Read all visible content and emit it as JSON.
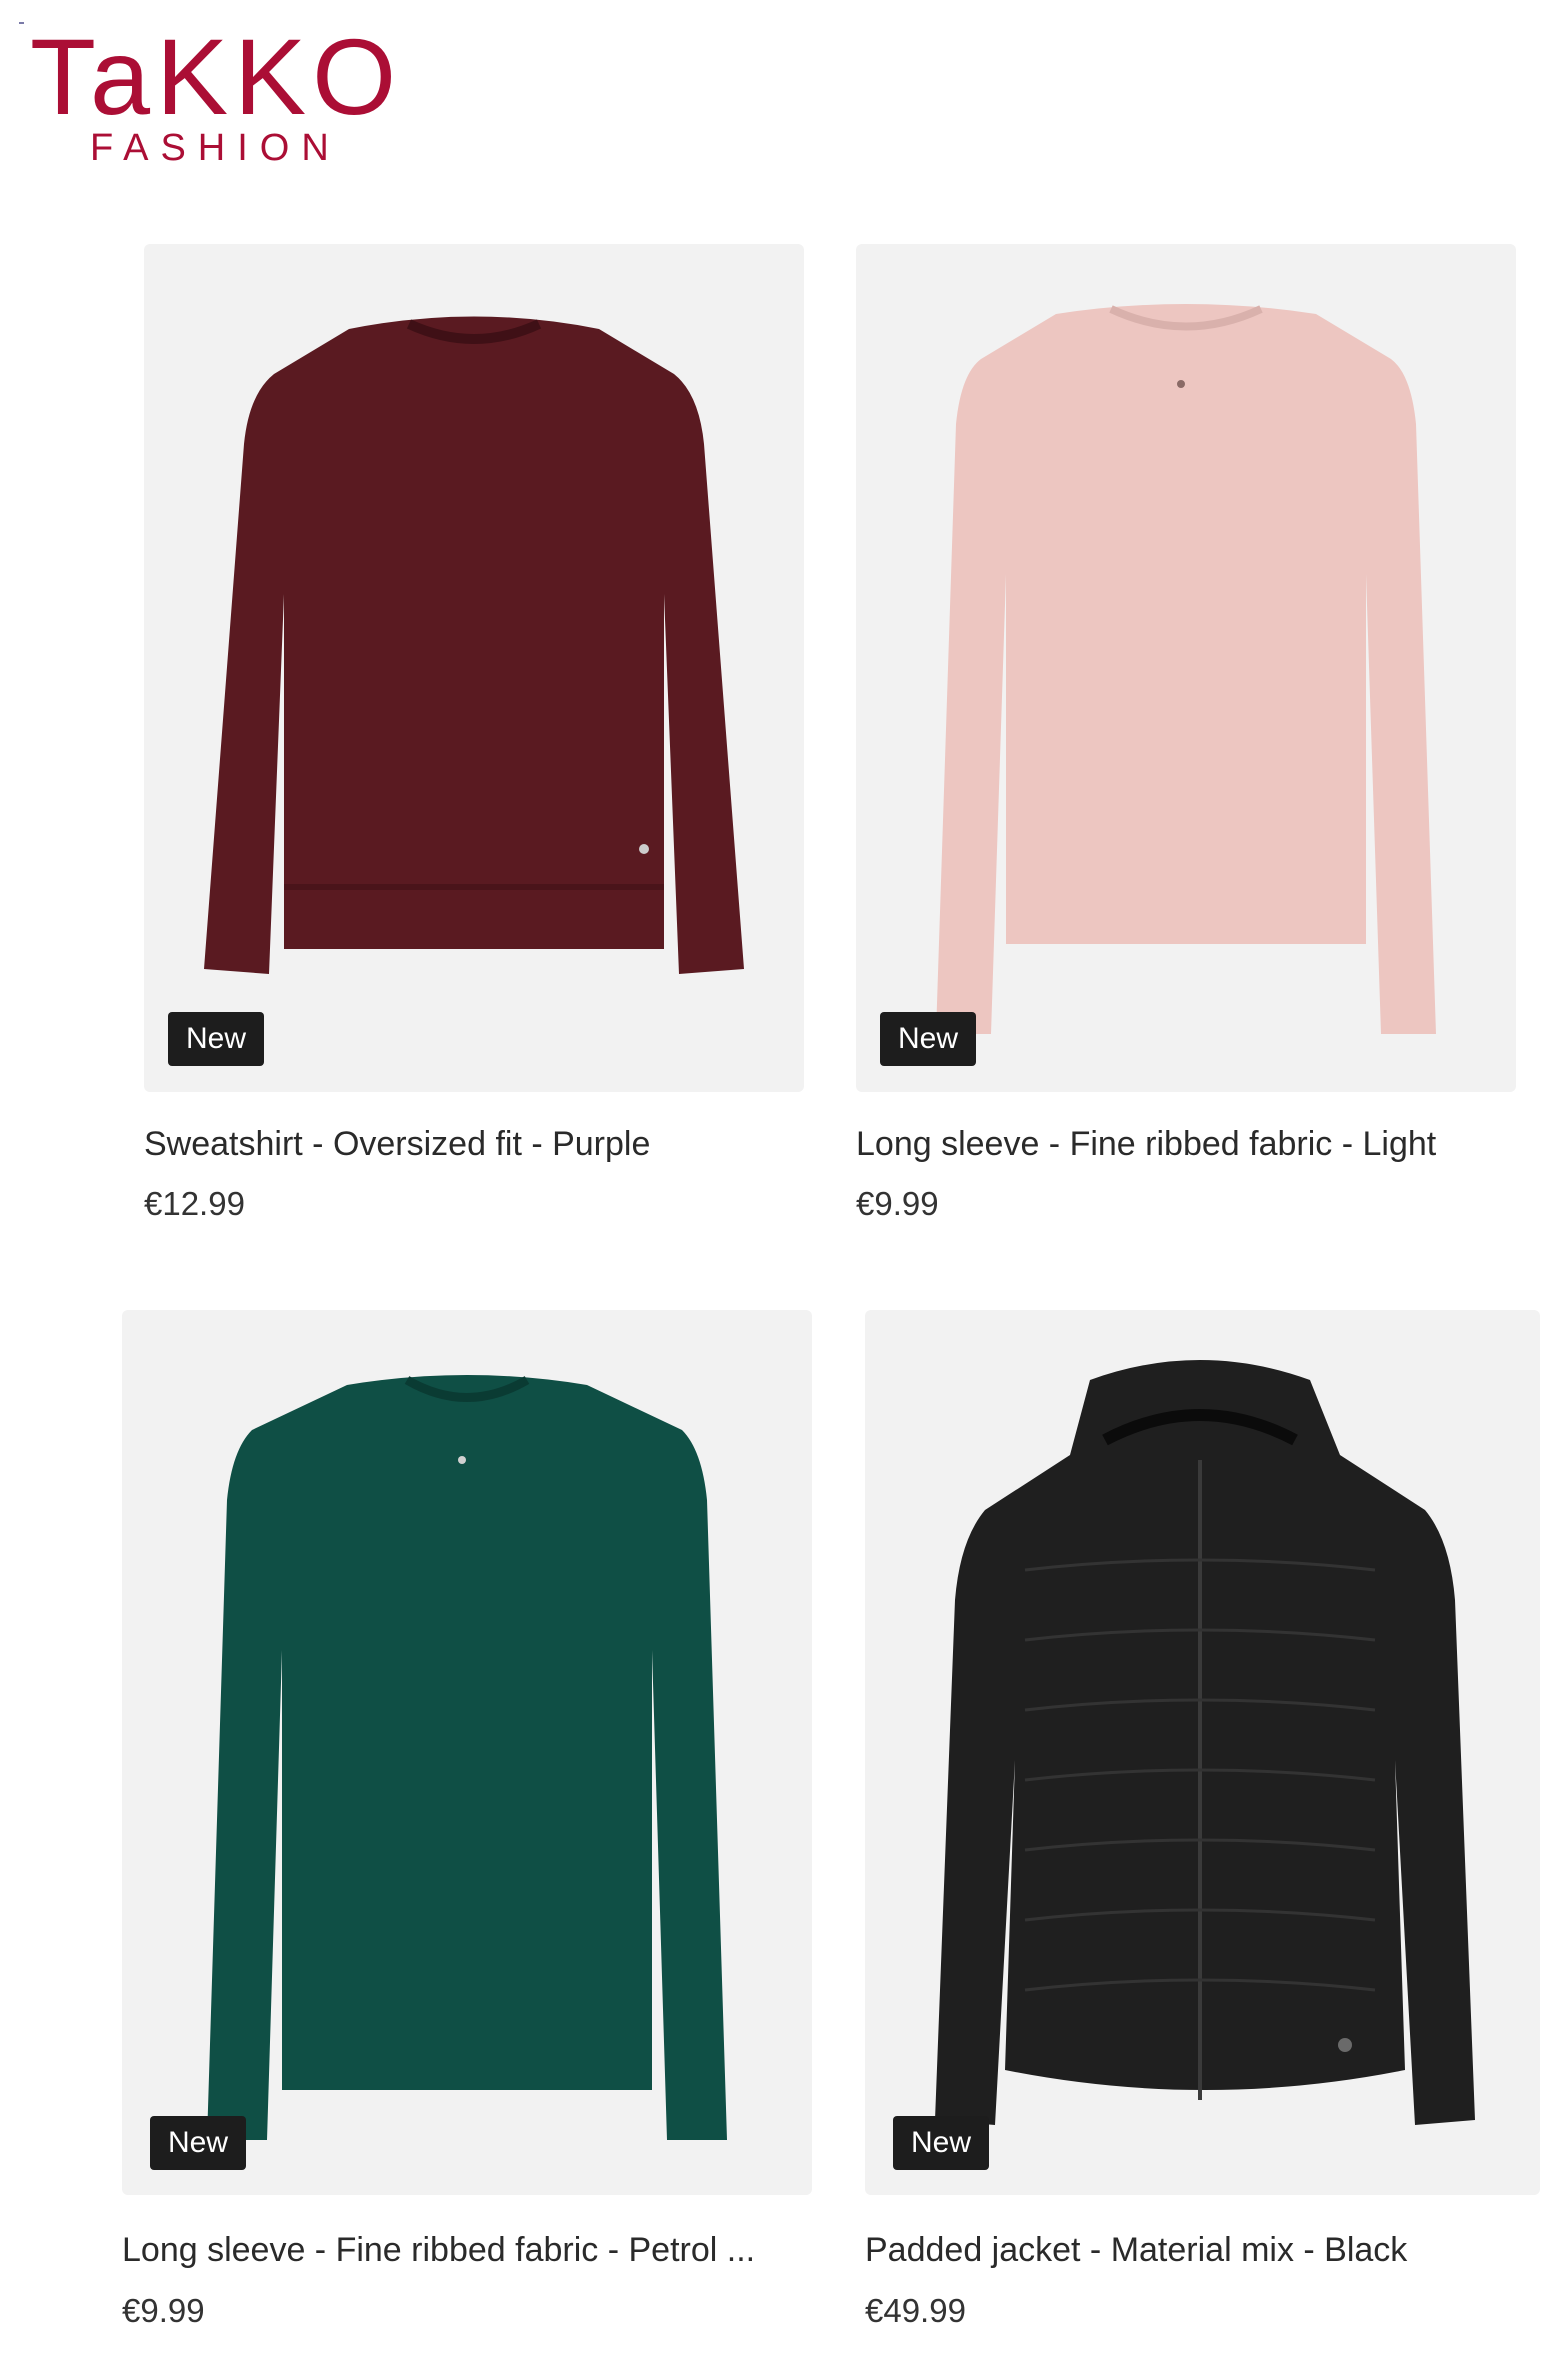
{
  "brand": {
    "name": "TaKKO",
    "tagline": "FASHION",
    "color": "#ab0e35"
  },
  "products": [
    {
      "title": "Sweatshirt - Oversized fit - Purple",
      "price": "€12.99",
      "badge": "New",
      "color": "#5a1a21",
      "garment": "sweatshirt"
    },
    {
      "title": "Long sleeve - Fine ribbed fabric - Light",
      "price": "€9.99",
      "badge": "New",
      "color": "#edc6c1",
      "garment": "long-sleeve"
    },
    {
      "title": "Long sleeve - Fine ribbed fabric - Petrol ...",
      "price": "€9.99",
      "badge": "New",
      "color": "#0f4f45",
      "garment": "long-sleeve"
    },
    {
      "title": "Padded jacket - Material mix - Black",
      "price": "€49.99",
      "badge": "New",
      "color": "#1f1f1f",
      "garment": "padded-jacket"
    }
  ]
}
